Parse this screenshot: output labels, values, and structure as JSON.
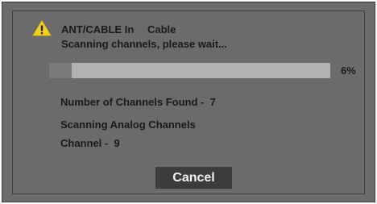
{
  "dialog": {
    "input_label": "ANT/CABLE In",
    "input_value": "Cable",
    "status": "Scanning channels, please wait...",
    "progress": {
      "percent": 6,
      "label": "6%"
    },
    "channels_found_label": "Number of Channels Found  -",
    "channels_found_value": "7",
    "scan_mode": "Scanning Analog Channels",
    "channel_label": "Channel  -",
    "channel_value": "9",
    "cancel_label": "Cancel",
    "warning_icon": "warning-triangle-icon"
  },
  "colors": {
    "dialog_bg": "#6b6b6b",
    "progress_track": "#b2b2b2",
    "progress_fill": "#7a7a7a",
    "warning_yellow": "#f2d21b",
    "button_bg": "#3c3c3c",
    "text": "#1a1a1a"
  }
}
